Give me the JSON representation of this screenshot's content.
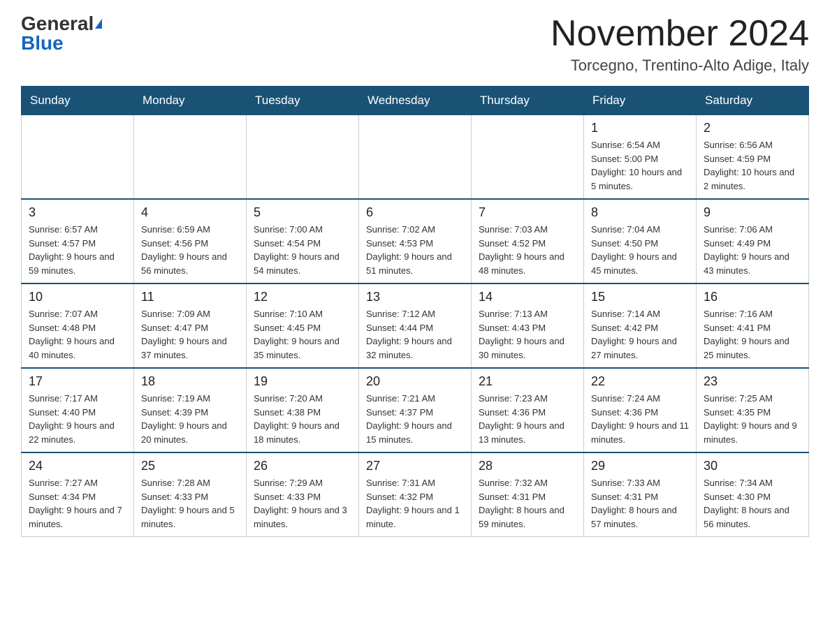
{
  "logo": {
    "general": "General",
    "blue": "Blue"
  },
  "title": "November 2024",
  "location": "Torcegno, Trentino-Alto Adige, Italy",
  "weekdays": [
    "Sunday",
    "Monday",
    "Tuesday",
    "Wednesday",
    "Thursday",
    "Friday",
    "Saturday"
  ],
  "weeks": [
    [
      {
        "day": "",
        "info": ""
      },
      {
        "day": "",
        "info": ""
      },
      {
        "day": "",
        "info": ""
      },
      {
        "day": "",
        "info": ""
      },
      {
        "day": "",
        "info": ""
      },
      {
        "day": "1",
        "info": "Sunrise: 6:54 AM\nSunset: 5:00 PM\nDaylight: 10 hours and 5 minutes."
      },
      {
        "day": "2",
        "info": "Sunrise: 6:56 AM\nSunset: 4:59 PM\nDaylight: 10 hours and 2 minutes."
      }
    ],
    [
      {
        "day": "3",
        "info": "Sunrise: 6:57 AM\nSunset: 4:57 PM\nDaylight: 9 hours and 59 minutes."
      },
      {
        "day": "4",
        "info": "Sunrise: 6:59 AM\nSunset: 4:56 PM\nDaylight: 9 hours and 56 minutes."
      },
      {
        "day": "5",
        "info": "Sunrise: 7:00 AM\nSunset: 4:54 PM\nDaylight: 9 hours and 54 minutes."
      },
      {
        "day": "6",
        "info": "Sunrise: 7:02 AM\nSunset: 4:53 PM\nDaylight: 9 hours and 51 minutes."
      },
      {
        "day": "7",
        "info": "Sunrise: 7:03 AM\nSunset: 4:52 PM\nDaylight: 9 hours and 48 minutes."
      },
      {
        "day": "8",
        "info": "Sunrise: 7:04 AM\nSunset: 4:50 PM\nDaylight: 9 hours and 45 minutes."
      },
      {
        "day": "9",
        "info": "Sunrise: 7:06 AM\nSunset: 4:49 PM\nDaylight: 9 hours and 43 minutes."
      }
    ],
    [
      {
        "day": "10",
        "info": "Sunrise: 7:07 AM\nSunset: 4:48 PM\nDaylight: 9 hours and 40 minutes."
      },
      {
        "day": "11",
        "info": "Sunrise: 7:09 AM\nSunset: 4:47 PM\nDaylight: 9 hours and 37 minutes."
      },
      {
        "day": "12",
        "info": "Sunrise: 7:10 AM\nSunset: 4:45 PM\nDaylight: 9 hours and 35 minutes."
      },
      {
        "day": "13",
        "info": "Sunrise: 7:12 AM\nSunset: 4:44 PM\nDaylight: 9 hours and 32 minutes."
      },
      {
        "day": "14",
        "info": "Sunrise: 7:13 AM\nSunset: 4:43 PM\nDaylight: 9 hours and 30 minutes."
      },
      {
        "day": "15",
        "info": "Sunrise: 7:14 AM\nSunset: 4:42 PM\nDaylight: 9 hours and 27 minutes."
      },
      {
        "day": "16",
        "info": "Sunrise: 7:16 AM\nSunset: 4:41 PM\nDaylight: 9 hours and 25 minutes."
      }
    ],
    [
      {
        "day": "17",
        "info": "Sunrise: 7:17 AM\nSunset: 4:40 PM\nDaylight: 9 hours and 22 minutes."
      },
      {
        "day": "18",
        "info": "Sunrise: 7:19 AM\nSunset: 4:39 PM\nDaylight: 9 hours and 20 minutes."
      },
      {
        "day": "19",
        "info": "Sunrise: 7:20 AM\nSunset: 4:38 PM\nDaylight: 9 hours and 18 minutes."
      },
      {
        "day": "20",
        "info": "Sunrise: 7:21 AM\nSunset: 4:37 PM\nDaylight: 9 hours and 15 minutes."
      },
      {
        "day": "21",
        "info": "Sunrise: 7:23 AM\nSunset: 4:36 PM\nDaylight: 9 hours and 13 minutes."
      },
      {
        "day": "22",
        "info": "Sunrise: 7:24 AM\nSunset: 4:36 PM\nDaylight: 9 hours and 11 minutes."
      },
      {
        "day": "23",
        "info": "Sunrise: 7:25 AM\nSunset: 4:35 PM\nDaylight: 9 hours and 9 minutes."
      }
    ],
    [
      {
        "day": "24",
        "info": "Sunrise: 7:27 AM\nSunset: 4:34 PM\nDaylight: 9 hours and 7 minutes."
      },
      {
        "day": "25",
        "info": "Sunrise: 7:28 AM\nSunset: 4:33 PM\nDaylight: 9 hours and 5 minutes."
      },
      {
        "day": "26",
        "info": "Sunrise: 7:29 AM\nSunset: 4:33 PM\nDaylight: 9 hours and 3 minutes."
      },
      {
        "day": "27",
        "info": "Sunrise: 7:31 AM\nSunset: 4:32 PM\nDaylight: 9 hours and 1 minute."
      },
      {
        "day": "28",
        "info": "Sunrise: 7:32 AM\nSunset: 4:31 PM\nDaylight: 8 hours and 59 minutes."
      },
      {
        "day": "29",
        "info": "Sunrise: 7:33 AM\nSunset: 4:31 PM\nDaylight: 8 hours and 57 minutes."
      },
      {
        "day": "30",
        "info": "Sunrise: 7:34 AM\nSunset: 4:30 PM\nDaylight: 8 hours and 56 minutes."
      }
    ]
  ]
}
